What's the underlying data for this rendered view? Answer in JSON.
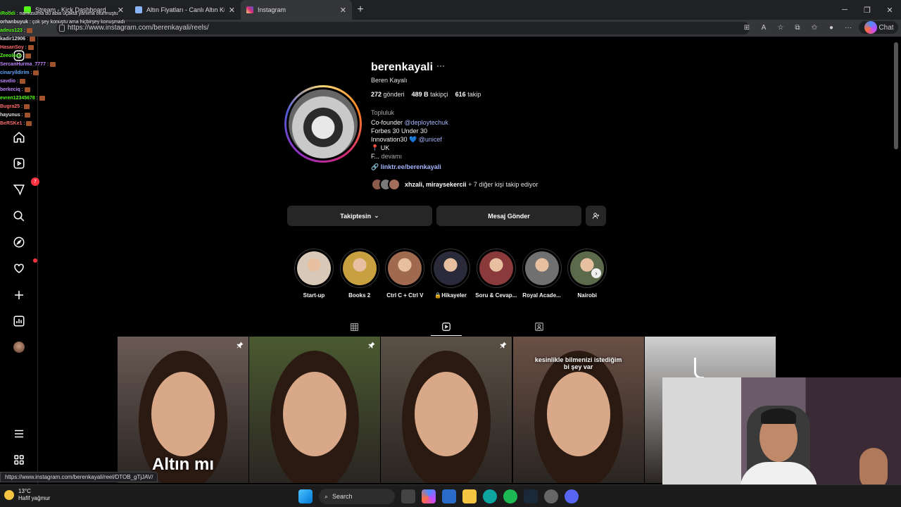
{
  "browser": {
    "tabs": [
      {
        "title": "Stream - Kick Dashboard",
        "fav_color": "#53fc18"
      },
      {
        "title": "Altın Fiyatları - Canlı Altın Kuru, Bu",
        "fav_color": "#8ab4f8"
      },
      {
        "title": "Instagram",
        "fav_color": "#d62976"
      }
    ],
    "url": "https://www.instagram.com/berenkayali/reels/",
    "chat_label": "Chat"
  },
  "stream_chat": [
    {
      "user": "iRoodi",
      "color": "#53fc18",
      "msg": "namusuma bu abla uçakta yanıma oturmuştu"
    },
    {
      "user": "orhanbuyuk",
      "color": "#e0e0e0",
      "msg": "çok şey konuştu ama hiçbirşey konuşmadı"
    },
    {
      "user": "adeus123",
      "color": "#53fc18",
      "msg": ""
    },
    {
      "user": "kadir12906",
      "color": "#e0e0e0",
      "msg": ""
    },
    {
      "user": "HasanSoy",
      "color": "#ff6b6b",
      "msg": ""
    },
    {
      "user": "Zeeolose",
      "color": "#53fc18",
      "msg": ""
    },
    {
      "user": "SercanHurma_7777",
      "color": "#c084fc",
      "msg": ""
    },
    {
      "user": "cinaryildirim",
      "color": "#60a5fa",
      "msg": ""
    },
    {
      "user": "savdio",
      "color": "#c084fc",
      "msg": ""
    },
    {
      "user": "berkeciq",
      "color": "#c084fc",
      "msg": ""
    },
    {
      "user": "evren12345678",
      "color": "#53fc18",
      "msg": ""
    },
    {
      "user": "Bugra25",
      "color": "#ff6b6b",
      "msg": ""
    },
    {
      "user": "hayunus",
      "color": "#e0e0e0",
      "msg": ""
    },
    {
      "user": "BeRSKe1",
      "color": "#ff6b6b",
      "msg": ""
    }
  ],
  "sidebar": {
    "notifications_count": "7"
  },
  "profile": {
    "username": "berenkayali",
    "more": "···",
    "full_name": "Beren Kayalı",
    "posts_count": "272",
    "posts_label": "gönderi",
    "followers_count": "489 B",
    "followers_label": "takipçi",
    "following_count": "616",
    "following_label": "takip",
    "category": "Topluluk",
    "bio_line1": "Co-founder ",
    "bio_line1_link": "@deploytechuk",
    "bio_line2": "Forbes 30 Under 30",
    "bio_line3": "Innovation30 💙 ",
    "bio_line3_link": "@unicef",
    "bio_line4": "📍 UK",
    "bio_line5_prefix": "F... ",
    "bio_more": "devamı",
    "link": "linktr.ee/berenkayali",
    "followed_by_names": "xhzali, miraysekercii",
    "followed_by_rest": " + 7 diğer kişi takip ediyor",
    "btn_following": "Takiptesin",
    "btn_message": "Mesaj Gönder"
  },
  "highlights": [
    {
      "label": "Start-up",
      "color": "#d8c8b8"
    },
    {
      "label": "Books 2",
      "color": "#c8a040"
    },
    {
      "label": "Ctrl C + Ctrl V",
      "color": "#a06a50"
    },
    {
      "label": "🔒Hikayeler",
      "color": "#2a2a3a"
    },
    {
      "label": "Soru & Cevap...",
      "color": "#8a3a3a"
    },
    {
      "label": "Royal Acade...",
      "color": "#707070"
    },
    {
      "label": "Nairobi",
      "color": "#5a6a4a"
    }
  ],
  "reels": [
    {
      "caption": "Altın mı",
      "bg": "#6a5a55",
      "pinned": true
    },
    {
      "caption": "",
      "bg": "#4a5a30",
      "pinned": true
    },
    {
      "caption": "",
      "bg": "#5a5045",
      "pinned": true
    },
    {
      "caption": "kesinlikle bilmenizi istediğim bi şey var",
      "bg": "#6a5045",
      "pinned": false
    },
    {
      "caption": "",
      "bg": "#cfcfcf",
      "pinned": false
    }
  ],
  "status_url": "https://www.instagram.com/berenkayali/reel/DTOB_gTjJAV/",
  "taskbar": {
    "temp": "13°C",
    "weather": "Hafif yağmur",
    "search": "Search"
  }
}
